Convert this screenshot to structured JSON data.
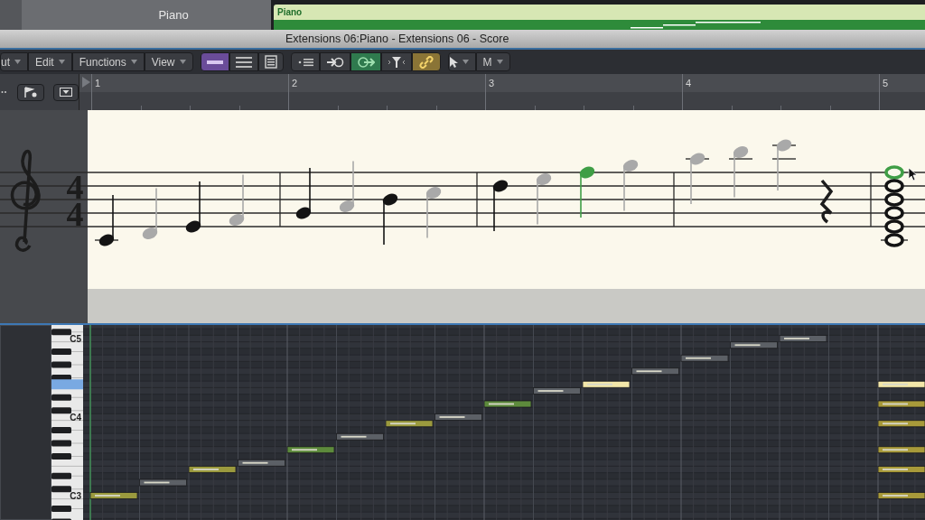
{
  "arrange": {
    "track_name": "Piano",
    "region_name": "Piano"
  },
  "window": {
    "title": "Extensions 06:Piano - Extensions 06 - Score"
  },
  "menus": [
    {
      "label": "ut"
    },
    {
      "label": "Edit"
    },
    {
      "label": "Functions"
    },
    {
      "label": "View"
    }
  ],
  "view_buttons": [
    {
      "kind": "linear",
      "selected": true
    },
    {
      "kind": "page",
      "selected": false
    },
    {
      "kind": "sheet",
      "selected": false
    }
  ],
  "toggles": [
    {
      "kind": "collapse",
      "on": false
    },
    {
      "kind": "midi-in",
      "on": false
    },
    {
      "kind": "midi-out",
      "on": true
    },
    {
      "kind": "filter",
      "on": false
    },
    {
      "kind": "link",
      "on": true
    }
  ],
  "tool_menus": [
    {
      "kind": "pointer"
    },
    {
      "kind": "text",
      "label": "M"
    }
  ],
  "ruler": {
    "bars": [
      "1",
      "2",
      "3",
      "4",
      "5"
    ]
  },
  "score": {
    "time_signature": {
      "numerator": "4",
      "denominator": "4"
    },
    "bars": [
      {
        "events": [
          {
            "kind": "note",
            "dimmed": false,
            "selected": false,
            "color": "#9b9a3e"
          },
          {
            "kind": "note",
            "dimmed": true,
            "selected": false,
            "color": "#5c6066"
          },
          {
            "kind": "note",
            "dimmed": false,
            "selected": false,
            "color": "#9b9a3e"
          },
          {
            "kind": "note",
            "dimmed": true,
            "selected": false,
            "color": "#5c6066"
          }
        ]
      },
      {
        "events": [
          {
            "kind": "note",
            "dimmed": false,
            "selected": false,
            "color": "#5d8a3c"
          },
          {
            "kind": "note",
            "dimmed": true,
            "selected": false,
            "color": "#5c6066"
          },
          {
            "kind": "note",
            "dimmed": false,
            "selected": false,
            "color": "#9b9a3e"
          },
          {
            "kind": "note",
            "dimmed": true,
            "selected": false,
            "color": "#5c6066"
          }
        ]
      },
      {
        "events": [
          {
            "kind": "note",
            "dimmed": false,
            "selected": false,
            "color": "#5d8a3c"
          },
          {
            "kind": "note",
            "dimmed": true,
            "selected": false,
            "color": "#5c6066"
          },
          {
            "kind": "note",
            "selected": true
          },
          {
            "kind": "note",
            "dimmed": true,
            "selected": false,
            "color": "#5c6066"
          }
        ]
      },
      {
        "events": [
          {
            "kind": "note",
            "dimmed": true,
            "selected": false,
            "color": "#5c6066"
          },
          {
            "kind": "note",
            "dimmed": true,
            "selected": false,
            "color": "#5c6066"
          },
          {
            "kind": "note",
            "dimmed": true,
            "selected": false,
            "color": "#5c6066"
          },
          {
            "kind": "rest"
          }
        ]
      },
      {
        "events": [
          {
            "kind": "chord",
            "notes": [
              {
                "selected": true
              },
              {
                "selected": false,
                "color": "#a89a3a"
              },
              {
                "selected": false,
                "color": "#a89a3a"
              },
              {
                "selected": false,
                "color": "#a89a3a"
              },
              {
                "selected": false,
                "color": "#a89a3a"
              },
              {
                "selected": false,
                "color": "#a89a3a"
              }
            ]
          }
        ]
      }
    ]
  },
  "piano_roll": {
    "key_labels": [
      "C5",
      "C4",
      "C3"
    ]
  }
}
